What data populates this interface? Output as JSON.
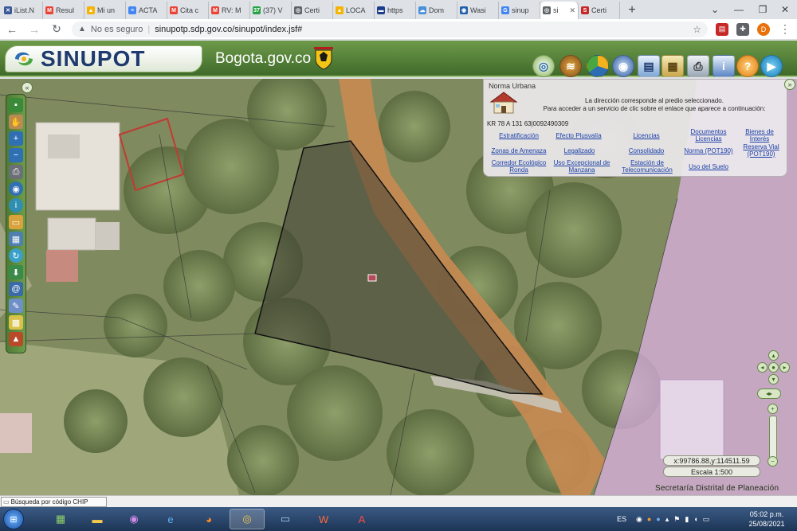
{
  "browser": {
    "tabs": [
      {
        "label": "iList.N",
        "color": "#3b5998",
        "glyph": "✕"
      },
      {
        "label": "Resul",
        "color": "#ea4335",
        "glyph": "M"
      },
      {
        "label": "Mi un",
        "color": "#f4b400",
        "glyph": "▲"
      },
      {
        "label": "ACTA",
        "color": "#4285f4",
        "glyph": "≡"
      },
      {
        "label": "Cita c",
        "color": "#ea4335",
        "glyph": "M"
      },
      {
        "label": "RV: M",
        "color": "#ea4335",
        "glyph": "M"
      },
      {
        "label": "(37) V",
        "color": "#25a244",
        "glyph": "37"
      },
      {
        "label": "Certi",
        "color": "#5f6368",
        "glyph": "◎"
      },
      {
        "label": "LOCA",
        "color": "#f4b400",
        "glyph": "▲"
      },
      {
        "label": "https",
        "color": "#1a3e8c",
        "glyph": "▬"
      },
      {
        "label": "Dom",
        "color": "#4a90d9",
        "glyph": "☁"
      },
      {
        "label": "Wasi",
        "color": "#1f5fa8",
        "glyph": "◉"
      },
      {
        "label": "sinup",
        "color": "#4285f4",
        "glyph": "G"
      },
      {
        "label": "si",
        "color": "#5f6368",
        "glyph": "◎",
        "active": true
      },
      {
        "label": "Certi",
        "color": "#c62828",
        "glyph": "S"
      }
    ],
    "insecure_label": "No es seguro",
    "url": "sinupotp.sdp.gov.co/sinupot/index.jsf#",
    "profile_initial": "D"
  },
  "app": {
    "logo_text": "SINUPOT",
    "portal_text": "Bogota.gov.co"
  },
  "info_panel": {
    "title": "Norma Urbana",
    "message_line1": "La dirección corresponde al predio seleccionado.",
    "message_line2": "Para acceder a un servicio de clic sobre el enlace que aparece a continuación:",
    "address": "KR 78 A 131 63|0092490309",
    "links": [
      {
        "label": "Estratificación"
      },
      {
        "label": "Efecto Plusvalía"
      },
      {
        "label": "Licencias"
      },
      {
        "label": "Documentos Licencias"
      },
      {
        "label": "Bienes de Interés"
      },
      {
        "label": "Zonas de Amenaza"
      },
      {
        "label": "Legalizado"
      },
      {
        "label": "Consolidado"
      },
      {
        "label": "Norma (POT190)"
      },
      {
        "label": "Reserva Vial (POT190)"
      },
      {
        "label": "Corredor Ecológico Ronda"
      },
      {
        "label": "Uso Excepcional de Manzana"
      },
      {
        "label": "Estación de Telecomunicación"
      },
      {
        "label": "Uso del Suelo"
      }
    ]
  },
  "map": {
    "coordinates": "x:99786.88,y:114511.59",
    "scale": "Escala 1:500",
    "footer": "Secretaría Distrital de Planeación"
  },
  "statusbar": {
    "chip_search": "Búsqueda por código CHIP"
  },
  "taskbar": {
    "language": "ES",
    "time": "05:02 p.m.",
    "date": "25/08/2021"
  }
}
